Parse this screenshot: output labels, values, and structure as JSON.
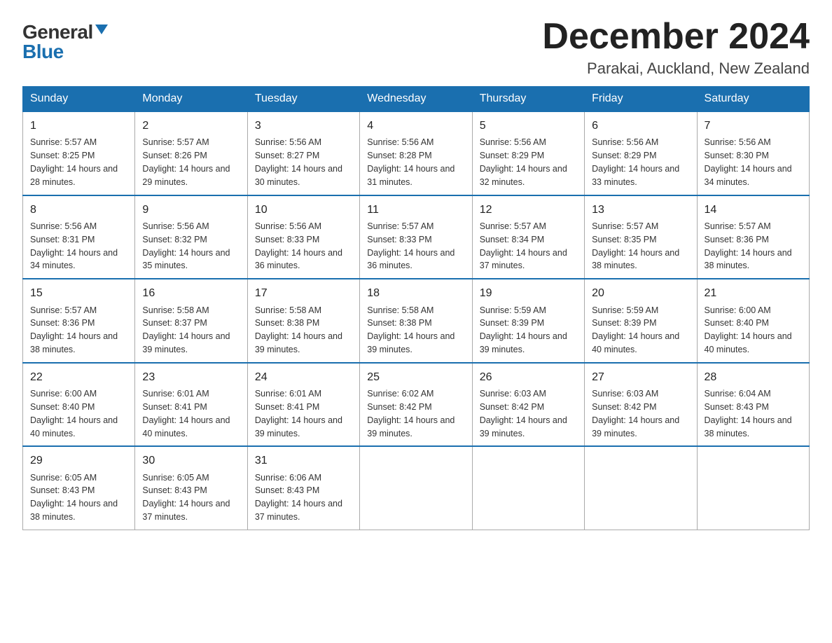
{
  "logo": {
    "general": "General",
    "blue": "Blue"
  },
  "title": "December 2024",
  "location": "Parakai, Auckland, New Zealand",
  "days_of_week": [
    "Sunday",
    "Monday",
    "Tuesday",
    "Wednesday",
    "Thursday",
    "Friday",
    "Saturday"
  ],
  "weeks": [
    [
      {
        "day": "1",
        "sunrise": "5:57 AM",
        "sunset": "8:25 PM",
        "daylight": "14 hours and 28 minutes."
      },
      {
        "day": "2",
        "sunrise": "5:57 AM",
        "sunset": "8:26 PM",
        "daylight": "14 hours and 29 minutes."
      },
      {
        "day": "3",
        "sunrise": "5:56 AM",
        "sunset": "8:27 PM",
        "daylight": "14 hours and 30 minutes."
      },
      {
        "day": "4",
        "sunrise": "5:56 AM",
        "sunset": "8:28 PM",
        "daylight": "14 hours and 31 minutes."
      },
      {
        "day": "5",
        "sunrise": "5:56 AM",
        "sunset": "8:29 PM",
        "daylight": "14 hours and 32 minutes."
      },
      {
        "day": "6",
        "sunrise": "5:56 AM",
        "sunset": "8:29 PM",
        "daylight": "14 hours and 33 minutes."
      },
      {
        "day": "7",
        "sunrise": "5:56 AM",
        "sunset": "8:30 PM",
        "daylight": "14 hours and 34 minutes."
      }
    ],
    [
      {
        "day": "8",
        "sunrise": "5:56 AM",
        "sunset": "8:31 PM",
        "daylight": "14 hours and 34 minutes."
      },
      {
        "day": "9",
        "sunrise": "5:56 AM",
        "sunset": "8:32 PM",
        "daylight": "14 hours and 35 minutes."
      },
      {
        "day": "10",
        "sunrise": "5:56 AM",
        "sunset": "8:33 PM",
        "daylight": "14 hours and 36 minutes."
      },
      {
        "day": "11",
        "sunrise": "5:57 AM",
        "sunset": "8:33 PM",
        "daylight": "14 hours and 36 minutes."
      },
      {
        "day": "12",
        "sunrise": "5:57 AM",
        "sunset": "8:34 PM",
        "daylight": "14 hours and 37 minutes."
      },
      {
        "day": "13",
        "sunrise": "5:57 AM",
        "sunset": "8:35 PM",
        "daylight": "14 hours and 38 minutes."
      },
      {
        "day": "14",
        "sunrise": "5:57 AM",
        "sunset": "8:36 PM",
        "daylight": "14 hours and 38 minutes."
      }
    ],
    [
      {
        "day": "15",
        "sunrise": "5:57 AM",
        "sunset": "8:36 PM",
        "daylight": "14 hours and 38 minutes."
      },
      {
        "day": "16",
        "sunrise": "5:58 AM",
        "sunset": "8:37 PM",
        "daylight": "14 hours and 39 minutes."
      },
      {
        "day": "17",
        "sunrise": "5:58 AM",
        "sunset": "8:38 PM",
        "daylight": "14 hours and 39 minutes."
      },
      {
        "day": "18",
        "sunrise": "5:58 AM",
        "sunset": "8:38 PM",
        "daylight": "14 hours and 39 minutes."
      },
      {
        "day": "19",
        "sunrise": "5:59 AM",
        "sunset": "8:39 PM",
        "daylight": "14 hours and 39 minutes."
      },
      {
        "day": "20",
        "sunrise": "5:59 AM",
        "sunset": "8:39 PM",
        "daylight": "14 hours and 40 minutes."
      },
      {
        "day": "21",
        "sunrise": "6:00 AM",
        "sunset": "8:40 PM",
        "daylight": "14 hours and 40 minutes."
      }
    ],
    [
      {
        "day": "22",
        "sunrise": "6:00 AM",
        "sunset": "8:40 PM",
        "daylight": "14 hours and 40 minutes."
      },
      {
        "day": "23",
        "sunrise": "6:01 AM",
        "sunset": "8:41 PM",
        "daylight": "14 hours and 40 minutes."
      },
      {
        "day": "24",
        "sunrise": "6:01 AM",
        "sunset": "8:41 PM",
        "daylight": "14 hours and 39 minutes."
      },
      {
        "day": "25",
        "sunrise": "6:02 AM",
        "sunset": "8:42 PM",
        "daylight": "14 hours and 39 minutes."
      },
      {
        "day": "26",
        "sunrise": "6:03 AM",
        "sunset": "8:42 PM",
        "daylight": "14 hours and 39 minutes."
      },
      {
        "day": "27",
        "sunrise": "6:03 AM",
        "sunset": "8:42 PM",
        "daylight": "14 hours and 39 minutes."
      },
      {
        "day": "28",
        "sunrise": "6:04 AM",
        "sunset": "8:43 PM",
        "daylight": "14 hours and 38 minutes."
      }
    ],
    [
      {
        "day": "29",
        "sunrise": "6:05 AM",
        "sunset": "8:43 PM",
        "daylight": "14 hours and 38 minutes."
      },
      {
        "day": "30",
        "sunrise": "6:05 AM",
        "sunset": "8:43 PM",
        "daylight": "14 hours and 37 minutes."
      },
      {
        "day": "31",
        "sunrise": "6:06 AM",
        "sunset": "8:43 PM",
        "daylight": "14 hours and 37 minutes."
      },
      null,
      null,
      null,
      null
    ]
  ]
}
